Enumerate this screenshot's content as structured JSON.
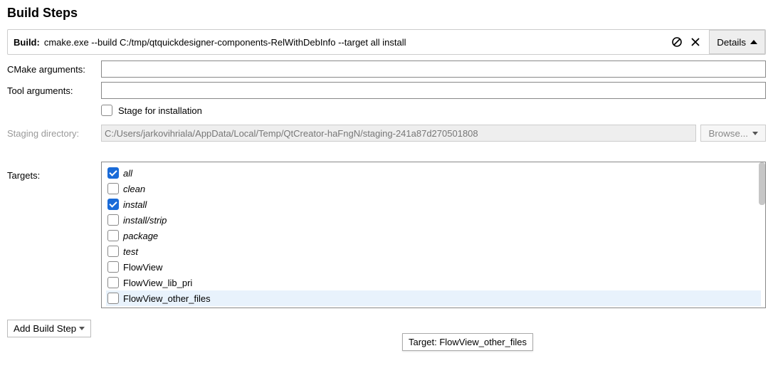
{
  "section_title": "Build Steps",
  "build": {
    "label": "Build:",
    "command": "cmake.exe --build C:/tmp/qtquickdesigner-components-RelWithDebInfo --target all install",
    "details_label": "Details"
  },
  "cmake_args": {
    "label": "CMake arguments:",
    "value": ""
  },
  "tool_args": {
    "label": "Tool arguments:",
    "value": ""
  },
  "stage_checkbox": {
    "label": "Stage for installation",
    "checked": false
  },
  "staging": {
    "label": "Staging directory:",
    "value": "C:/Users/jarkovihriala/AppData/Local/Temp/QtCreator-haFngN/staging-241a87d270501808",
    "browse_label": "Browse..."
  },
  "targets": {
    "label": "Targets:",
    "items": [
      {
        "label": "all",
        "checked": true,
        "italic": true
      },
      {
        "label": "clean",
        "checked": false,
        "italic": true
      },
      {
        "label": "install",
        "checked": true,
        "italic": true
      },
      {
        "label": "install/strip",
        "checked": false,
        "italic": true
      },
      {
        "label": "package",
        "checked": false,
        "italic": true
      },
      {
        "label": "test",
        "checked": false,
        "italic": true
      },
      {
        "label": "FlowView",
        "checked": false,
        "italic": false
      },
      {
        "label": "FlowView_lib_pri",
        "checked": false,
        "italic": false
      },
      {
        "label": "FlowView_other_files",
        "checked": false,
        "italic": false,
        "hovered": true
      }
    ]
  },
  "add_step_label": "Add Build Step",
  "tooltip_text": "Target: FlowView_other_files"
}
